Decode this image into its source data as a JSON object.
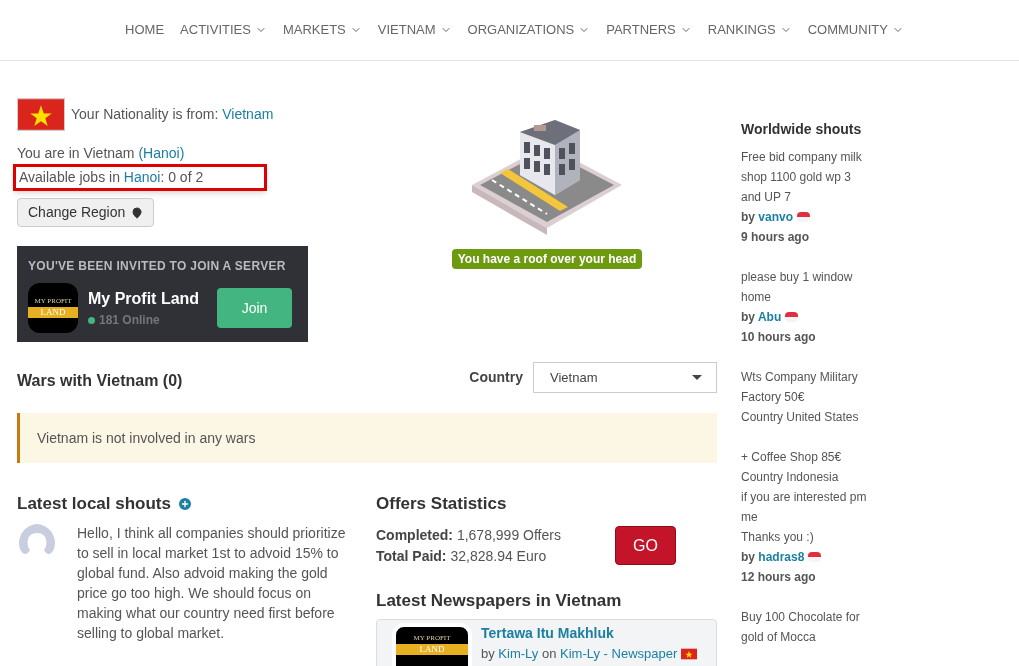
{
  "nav": [
    {
      "label": "HOME",
      "has_menu": false
    },
    {
      "label": "ACTIVITIES",
      "has_menu": true
    },
    {
      "label": "MARKETS",
      "has_menu": true
    },
    {
      "label": "VIETNAM",
      "has_menu": true
    },
    {
      "label": "ORGANIZATIONS",
      "has_menu": true
    },
    {
      "label": "PARTNERS",
      "has_menu": true
    },
    {
      "label": "RANKINGS",
      "has_menu": true
    },
    {
      "label": "COMMUNITY",
      "has_menu": true
    }
  ],
  "nationality": {
    "label": "Your Nationality is from:",
    "country": "Vietnam"
  },
  "location": {
    "prefix": "You are in Vietnam",
    "region": "(Hanoi)"
  },
  "jobs": {
    "prefix": "Available jobs in",
    "region": "Hanoi",
    "count": ": 0 of 2",
    "highlighted": true
  },
  "change_region_button": "Change Region",
  "invite": {
    "heading": "YOU'VE BEEN INVITED TO JOIN A SERVER",
    "logo_top": "MY PROFIT",
    "logo_band": "LAND",
    "server": "My Profit Land",
    "online": "181 Online",
    "join": "Join"
  },
  "housing_badge": "You have a roof over your head",
  "wars": {
    "title": "Wars with Vietnam (0)",
    "country_label": "Country",
    "country_value": "Vietnam",
    "notice": "Vietnam is not involved in any wars"
  },
  "local_shouts": {
    "title": "Latest local shouts",
    "items": [
      {
        "text": "Hello, I think all companies should prioritize to sell in local market 1st to advoid 15% to global fund. Also advoid making the gold price go too high. We should focus on making what our country need first before selling to global market."
      }
    ]
  },
  "offers": {
    "title": "Offers Statistics",
    "completed_label": "Completed:",
    "completed": "1,678,999 Offers",
    "paid_label": "Total Paid:",
    "paid": "32,828.94 Euro",
    "go": "GO"
  },
  "newspapers": {
    "title": "Latest Newspapers in Vietnam",
    "items": [
      {
        "logo_top": "MY PROFIT",
        "logo_band": "LAND",
        "title": "Tertawa Itu Makhluk",
        "by": "by",
        "author": "Kim-Ly",
        "on": "on",
        "paper": "Kim-Ly - Newspaper"
      }
    ]
  },
  "worldwide_shouts": {
    "title": "Worldwide shouts",
    "items": [
      {
        "text": "Free bid company milk shop 1100 gold wp 3 and UP 7",
        "by": "by",
        "author": "vanvo",
        "time": "9 hours ago"
      },
      {
        "text": "please buy 1 window home",
        "by": "by",
        "author": "Abu",
        "time": "10 hours ago"
      },
      {
        "text": "Wts Company Military Factory 50€\nCountry United States\n\n+ Coffee Shop 85€\nCountry Indonesia\nif you are interested pm me\nThanks you :)",
        "by": "by",
        "author": "hadras8",
        "time": "12 hours ago"
      },
      {
        "text": "Buy 100 Chocolate for gold of Mocca"
      }
    ]
  }
}
